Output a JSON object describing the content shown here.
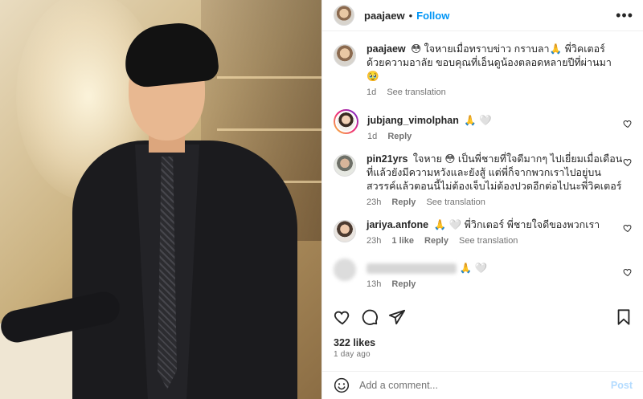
{
  "post": {
    "username": "paajaew",
    "follow_label": "Follow",
    "separator": "•",
    "more_label": "•••"
  },
  "caption": {
    "username": "paajaew",
    "text": "😳 ใจหายเมื่อทราบข่าว กราบลา🙏 พี่วิคเตอร์ ด้วยความอาลัย ขอบคุณที่เอ็นดูน้องตลอดหลายปีที่ผ่านมา 🥹",
    "time": "1d",
    "see_translation": "See translation"
  },
  "comments": [
    {
      "username": "jubjang_vimolphan",
      "text": "🙏 🤍",
      "time": "1d",
      "likes": "",
      "reply": "Reply",
      "see_translation": ""
    },
    {
      "username": "pin21yrs",
      "text": "ใจหาย 😳 เป็นพี่ชายที่ใจดีมากๆ ไปเยี่ยมเมื่อเดือนที่แล้วยังมีความหวังและยังสู้ แต่พี่ก็จากพวกเราไปอยู่บนสวรรค์แล้วตอนนี้ไม่ต้องเจ็บไม่ต้องปวดอีกต่อไปนะพี่วิคเตอร์",
      "time": "23h",
      "likes": "",
      "reply": "Reply",
      "see_translation": "See translation"
    },
    {
      "username": "jariya.anfone",
      "text": "🙏 🤍 พี่วิกเตอร์ พี่ชายใจดีของพวกเรา",
      "time": "23h",
      "likes": "1 like",
      "reply": "Reply",
      "see_translation": "See translation"
    },
    {
      "username": "",
      "text": "🙏 🤍",
      "time": "13h",
      "likes": "",
      "reply": "Reply",
      "see_translation": ""
    }
  ],
  "stats": {
    "likes": "322 likes",
    "ago": "1 day ago"
  },
  "add_comment": {
    "placeholder": "Add a comment...",
    "post_label": "Post"
  },
  "icons": [
    "heart-icon",
    "comment-icon",
    "share-icon",
    "bookmark-icon",
    "smile-icon",
    "more-icon"
  ],
  "colors": {
    "accent": "#0095f6",
    "post_disabled": "#b3dbff",
    "muted": "#737373"
  }
}
